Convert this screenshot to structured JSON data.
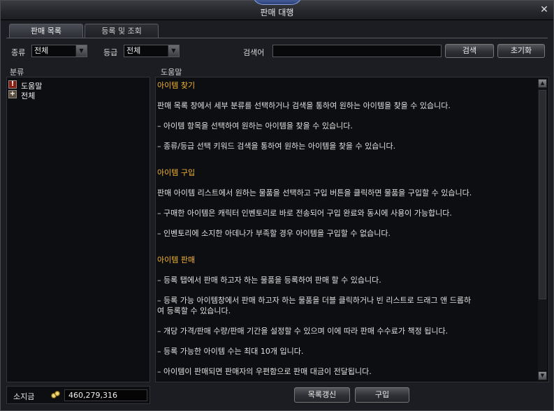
{
  "window": {
    "title": "판매 대행",
    "close_glyph": "✕"
  },
  "tabs": [
    {
      "label": "판매 목록",
      "active": true
    },
    {
      "label": "등록 및 조회",
      "active": false
    }
  ],
  "filters": {
    "type_label": "종류",
    "type_value": "전체",
    "grade_label": "등급",
    "grade_value": "전체",
    "search_label": "검색어",
    "search_value": "",
    "search_button": "검색",
    "reset_button": "초기화"
  },
  "left_panel": {
    "header": "분류",
    "items": [
      {
        "label": "도움말",
        "icon": "help-icon"
      },
      {
        "label": "전체",
        "icon": "plus-icon"
      }
    ]
  },
  "right_panel": {
    "header": "도움말",
    "lines": [
      {
        "text": "아이템 찾기",
        "heading": true
      },
      {
        "text": "판매 목록 창에서 세부 분류를 선택하거나 검색을 통하여 원하는 아이템을 찾을 수 있습니다.",
        "heading": false
      },
      {
        "text": "– 아이템 항목을 선택하여 원하는 아이템을 찾을 수 있습니다.",
        "heading": false
      },
      {
        "text": "– 종류/등급 선택 키워드 검색을 통하여 원하는 아이템을 찾을 수 있습니다.",
        "heading": false
      },
      {
        "text": "아이템 구입",
        "heading": true
      },
      {
        "text": "판매 아이템 리스트에서 원하는 물품을 선택하고 구입 버튼을 클릭하면 물품을 구입할 수 있습니다.",
        "heading": false
      },
      {
        "text": "– 구매한 아이템은 캐릭터 인벤토리로 바로 전송되어 구입 완료와 동시에 사용이 가능합니다.",
        "heading": false
      },
      {
        "text": "– 인벤토리에 소지한 아데나가 부족할 경우 아이템을 구입할 수 없습니다.",
        "heading": false
      },
      {
        "text": "아이템 판매",
        "heading": true
      },
      {
        "text": "– 등록 탭에서 판매 하고자 하는 물품을 등록하여 판매 할 수 있습니다.",
        "heading": false
      },
      {
        "text": "– 등록 가능 아이템창에서 판매 하고자 하는 물품을 더블 클릭하거나 빈 리스트로 드래그 앤 드롭하",
        "heading": false
      },
      {
        "text": "여 등록할 수 있습니다.",
        "heading": false
      },
      {
        "text": "– 개당 가격/판매 수량/판매 기간을 설정할 수 있으며 이에 따라 판매 수수료가 책정 됩니다.",
        "heading": false
      },
      {
        "text": "– 등록 가능한 아이템 수는 최대 10개 입니다.",
        "heading": false
      },
      {
        "text": "– 아이템이 판매되면 판매자의 우편함으로 판매 대금이 전달됩니다.",
        "heading": false
      }
    ]
  },
  "bottom": {
    "money_label": "소지금",
    "money_value": "460,279,316",
    "refresh_button": "목록갱신",
    "buy_button": "구입"
  },
  "colors": {
    "heading": "#f2b233",
    "text": "#e0e0e0",
    "panel_bg": "#0d0e11",
    "window_bg": "#1b1d22"
  }
}
